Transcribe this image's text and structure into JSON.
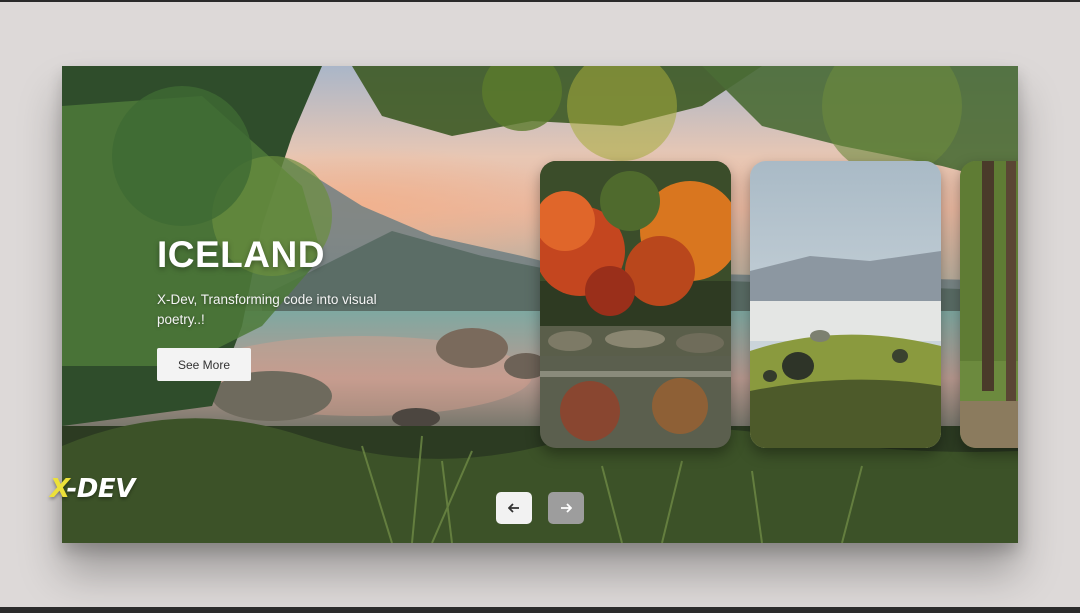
{
  "hero": {
    "title": "ICELAND",
    "description": "X-Dev, Transforming code into visual poetry..!",
    "button_label": "See More"
  },
  "carousel": {
    "cards": [
      {
        "name": "autumn-stream"
      },
      {
        "name": "misty-meadow"
      },
      {
        "name": "forest-path"
      }
    ],
    "prev_icon": "arrow-left-icon",
    "next_icon": "arrow-right-icon"
  },
  "logo": {
    "mark": "X",
    "text": "-DEV",
    "accent_color": "#ece13a"
  }
}
